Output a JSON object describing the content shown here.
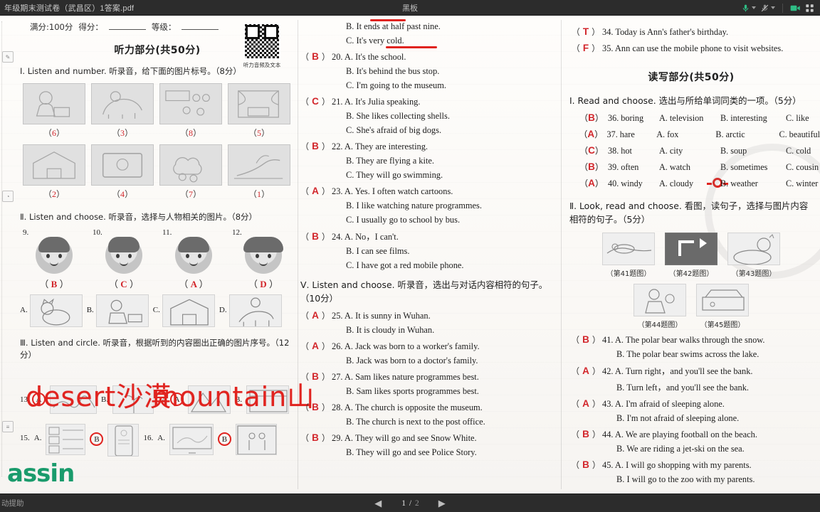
{
  "topbar": {
    "file_title": "年级期末测试卷（武昌区）1答案.pdf",
    "center_title": "黑板",
    "icons": {
      "mic": "microphone-icon",
      "mic_caret": "chevron-down-icon",
      "camera_off": "camera-off-icon",
      "camera_caret": "chevron-down-icon",
      "video": "video-camera-icon",
      "grid": "grid-layout-icon"
    },
    "accent_green": "#2fbd85"
  },
  "bottombar": {
    "left_text": "动提助",
    "prev_icon": "previous-page-icon",
    "next_icon": "next-page-icon",
    "current_page": "1",
    "separator": "/",
    "total_pages": "2"
  },
  "document": {
    "header": {
      "full_score_label": "满分:100分",
      "score_label": "得分：",
      "grade_label": "等级：",
      "qr_caption": "听力音频及文本"
    },
    "listening": {
      "section_title": "听力部分(共50分)",
      "part1": {
        "instruction": "Ⅰ. Listen and number. 听录音，给下面的图片标号。（8分）",
        "answers_row1": [
          "6",
          "3",
          "8",
          "5"
        ],
        "answers_row2": [
          "2",
          "4",
          "7",
          "1"
        ]
      },
      "part2": {
        "instruction": "Ⅱ. Listen and choose. 听录音，选择与人物相关的图片。（8分）",
        "numbers": [
          "9.",
          "10.",
          "11.",
          "12."
        ],
        "answers": [
          "B",
          "C",
          "A",
          "D"
        ],
        "option_labels": [
          "A.",
          "B.",
          "C.",
          "D."
        ]
      },
      "part3": {
        "instruction": "Ⅲ. Listen and circle. 听录音，根据听到的内容圈出正确的图片序号。（12分）",
        "rows": [
          {
            "q1_num": "13",
            "q1_a": "A.",
            "q1_b": "B.",
            "q2_num": "14",
            "q2_a": "A.",
            "q2_b": "B."
          },
          {
            "q1_num": "15.",
            "q1_a": "A.",
            "q1_b": "B.",
            "q2_num": "16.",
            "q2_a": "A.",
            "q2_b": "B."
          }
        ],
        "circled": [
          "A",
          "A",
          "B",
          "B"
        ]
      },
      "handwriting": {
        "desert": "desert沙漠",
        "mountain": "mountain山"
      }
    },
    "middle_column": {
      "top_fragments": [
        {
          "text": "B. It ends at half past nine.",
          "answer": ""
        },
        {
          "text": "C. It's very cold.",
          "answer": ""
        }
      ],
      "questions": [
        {
          "answer": "B",
          "num": "20.",
          "opts": [
            "A. It's the school.",
            "B. It's behind the bus stop.",
            "C. I'm going to the museum."
          ]
        },
        {
          "answer": "C",
          "num": "21.",
          "opts": [
            "A. It's Julia speaking.",
            "B. She likes collecting shells.",
            "C. She's afraid of big dogs."
          ]
        },
        {
          "answer": "B",
          "num": "22.",
          "opts": [
            "A. They are interesting.",
            "B. They are flying a kite.",
            "C. They will go swimming."
          ]
        },
        {
          "answer": "A",
          "num": "23.",
          "opts": [
            "A. Yes. I often watch cartoons.",
            "B. I like watching nature programmes.",
            "C. I usually go to school by bus."
          ]
        },
        {
          "answer": "B",
          "num": "24.",
          "opts": [
            "A. No，I can't.",
            "B. I can see films.",
            "C. I have got a red mobile phone."
          ]
        }
      ],
      "part5": {
        "instruction": "Ⅴ. Listen and choose. 听录音，选出与对话内容相符的句子。（10分）",
        "questions": [
          {
            "answer": "A",
            "num": "25.",
            "opts": [
              "A. It is sunny in Wuhan.",
              "B. It is cloudy in Wuhan."
            ]
          },
          {
            "answer": "A",
            "num": "26.",
            "opts": [
              "A. Jack was born to a worker's family.",
              "B. Jack was born to a doctor's family."
            ]
          },
          {
            "answer": "B",
            "num": "27.",
            "opts": [
              "A. Sam likes nature programmes best.",
              "B. Sam likes sports programmes best."
            ]
          },
          {
            "answer": "B",
            "num": "28.",
            "opts": [
              "A. The church is opposite the museum.",
              "B. The church is next to the post office."
            ]
          },
          {
            "answer": "B",
            "num": "29.",
            "opts": [
              "A. They will go and see Snow White.",
              "B. They will go and see Police Story."
            ]
          }
        ]
      }
    },
    "right_column": {
      "top_questions": [
        {
          "answer": "T",
          "num": "34.",
          "text": "Today is Ann's father's birthday."
        },
        {
          "answer": "F",
          "num": "35.",
          "text": "Ann can use the mobile phone to visit websites."
        }
      ],
      "section_title": "读写部分(共50分)",
      "part1": {
        "instruction": "Ⅰ. Read and choose. 选出与所给单词同类的一项。（5分）",
        "rows": [
          {
            "answer": "B",
            "num": "36.",
            "word": "boring",
            "a": "A. television",
            "b": "B. interesting",
            "c": "C. like"
          },
          {
            "answer": "A",
            "num": "37.",
            "word": "hare",
            "a": "A. fox",
            "b": "B. arctic",
            "c": "C. beautiful"
          },
          {
            "answer": "C",
            "num": "38.",
            "word": "hot",
            "a": "A. city",
            "b": "B. soup",
            "c": "C. cold"
          },
          {
            "answer": "B",
            "num": "39.",
            "word": "often",
            "a": "A. watch",
            "b": "B. sometimes",
            "c": "C. cousin"
          },
          {
            "answer": "A",
            "num": "40.",
            "word": "windy",
            "a": "A. cloudy",
            "b": "B. weather",
            "c": "C. winter"
          }
        ]
      },
      "part2": {
        "instruction": "Ⅱ. Look, read and choose. 看图，读句子，选择与图片内容相符的句子。（5分）",
        "figure_captions_row1": [
          "（第41题图）",
          "（第42题图）",
          "（第43题图）"
        ],
        "figure_captions_row2": [
          "（第44题图）",
          "（第45题图）"
        ],
        "questions": [
          {
            "answer": "B",
            "num": "41.",
            "opts": [
              "A. The polar bear walks through the snow.",
              "B. The polar bear swims across the lake."
            ]
          },
          {
            "answer": "A",
            "num": "42.",
            "opts": [
              "A. Turn right，and you'll see the bank.",
              "B. Turn left，and you'll see the bank."
            ]
          },
          {
            "answer": "A",
            "num": "43.",
            "opts": [
              "A. I'm afraid of sleeping alone.",
              "B. I'm not afraid of sleeping alone."
            ]
          },
          {
            "answer": "B",
            "num": "44.",
            "opts": [
              "A. We are playing football on the beach.",
              "B. We are riding a jet-ski on the sea."
            ]
          },
          {
            "answer": "B",
            "num": "45.",
            "opts": [
              "A. I will go shopping with my parents.",
              "B. I will go to the zoo with my parents."
            ]
          }
        ]
      }
    },
    "watermark_logo": "assin",
    "ink_color": "#e0231f"
  }
}
